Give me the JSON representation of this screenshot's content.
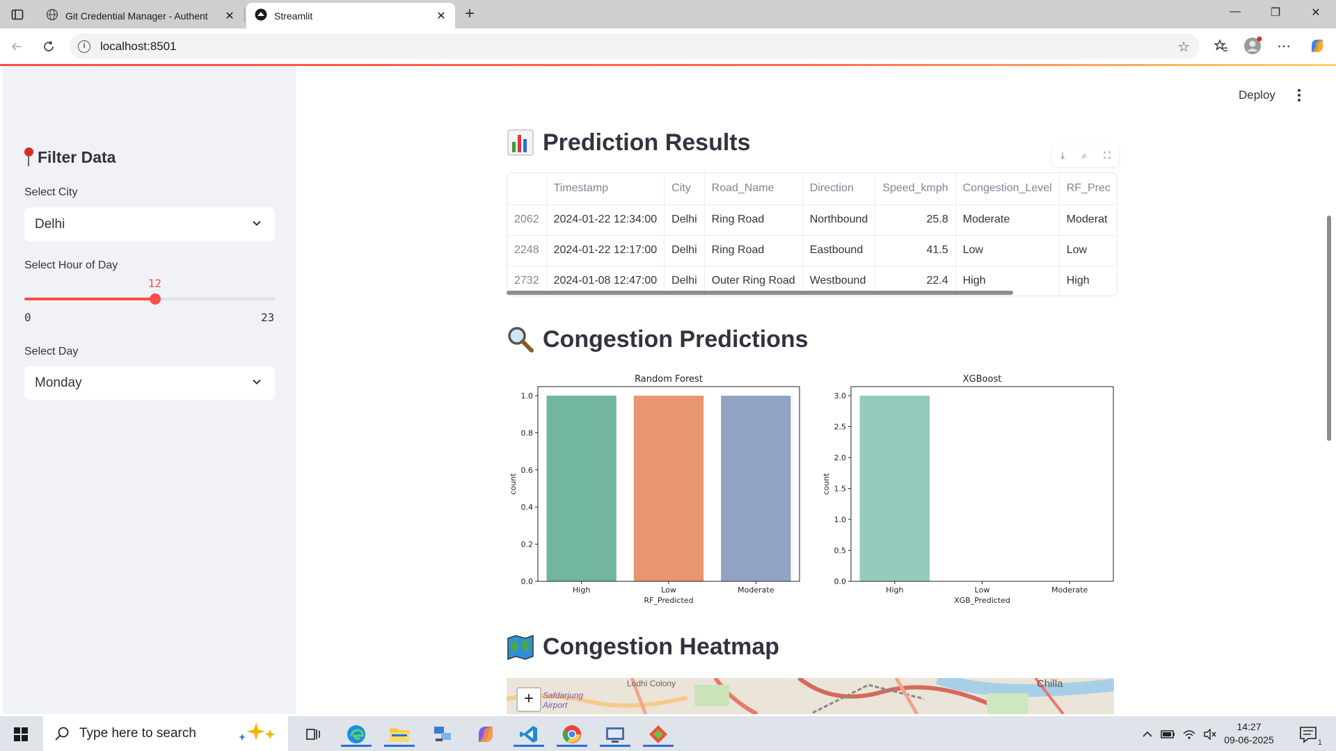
{
  "browser": {
    "tabs": [
      {
        "title": "Git Credential Manager - Authent",
        "active": false
      },
      {
        "title": "Streamlit",
        "active": true
      }
    ],
    "url": "localhost:8501"
  },
  "app": {
    "deploy_label": "Deploy"
  },
  "sidebar": {
    "title": "Filter Data",
    "city": {
      "label": "Select City",
      "value": "Delhi"
    },
    "hour": {
      "label": "Select Hour of Day",
      "value": "12",
      "min": "0",
      "max": "23",
      "fraction": 0.5217
    },
    "day": {
      "label": "Select Day",
      "value": "Monday"
    }
  },
  "sections": {
    "prediction_results": "Prediction Results",
    "congestion_predictions": "Congestion Predictions",
    "congestion_heatmap": "Congestion Heatmap"
  },
  "table": {
    "columns": [
      "",
      "Timestamp",
      "City",
      "Road_Name",
      "Direction",
      "Speed_kmph",
      "Congestion_Level",
      "RF_Prec"
    ],
    "rows": [
      [
        "2062",
        "2024-01-22 12:34:00",
        "Delhi",
        "Ring Road",
        "Northbound",
        "25.8",
        "Moderate",
        "Moderat"
      ],
      [
        "2248",
        "2024-01-22 12:17:00",
        "Delhi",
        "Ring Road",
        "Eastbound",
        "41.5",
        "Low",
        "Low"
      ],
      [
        "2732",
        "2024-01-08 12:47:00",
        "Delhi",
        "Outer Ring Road",
        "Westbound",
        "22.4",
        "High",
        "High"
      ]
    ]
  },
  "chart_data": [
    {
      "type": "bar",
      "title": "Random Forest",
      "xlabel": "RF_Predicted",
      "ylabel": "count",
      "categories": [
        "High",
        "Low",
        "Moderate"
      ],
      "values": [
        1,
        1,
        1
      ],
      "ylim": [
        0,
        1.0
      ],
      "yticks": [
        "0.0",
        "0.2",
        "0.4",
        "0.6",
        "0.8",
        "1.0"
      ],
      "colors": [
        "#72b5a0",
        "#e8966f",
        "#91a2c4"
      ]
    },
    {
      "type": "bar",
      "title": "XGBoost",
      "xlabel": "XGB_Predicted",
      "ylabel": "count",
      "categories": [
        "High",
        "Low",
        "Moderate"
      ],
      "values": [
        3,
        0,
        0
      ],
      "ylim": [
        0,
        3.0
      ],
      "yticks": [
        "0.0",
        "0.5",
        "1.0",
        "1.5",
        "2.0",
        "2.5",
        "3.0"
      ],
      "colors": [
        "#96cabf",
        "#e8966f",
        "#91a2c4"
      ]
    }
  ],
  "map": {
    "labels": [
      "Lodhi Colony",
      "Safdarjung Airport",
      "Chilla"
    ],
    "zoom_in": "+"
  },
  "taskbar": {
    "search_placeholder": "Type here to search",
    "time": "14:27",
    "date": "09-06-2025",
    "notification_count": "1"
  },
  "colors": {
    "accent": "#ff4b4b",
    "sidebar_bg": "#f0f2f6"
  }
}
